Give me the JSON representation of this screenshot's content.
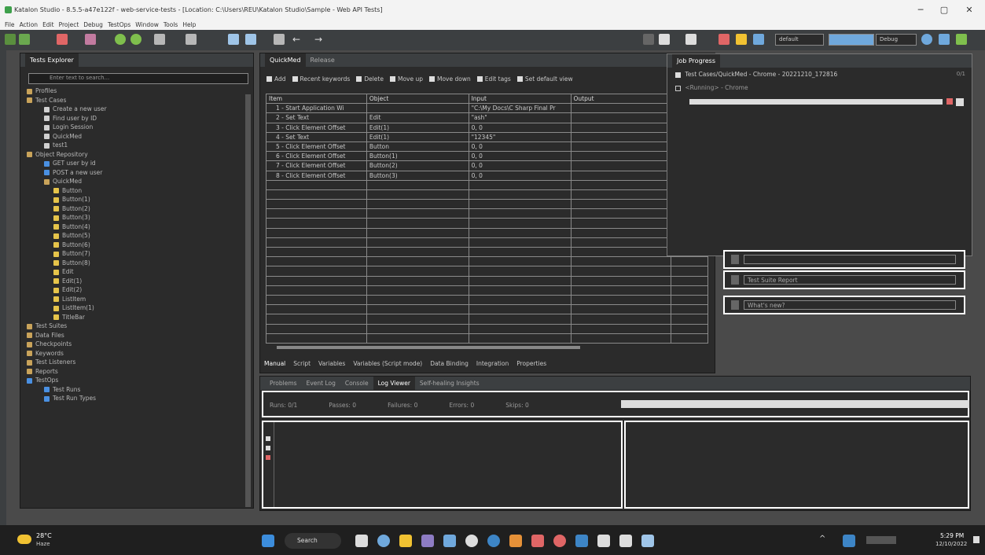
{
  "window": {
    "title": "Katalon Studio - 8.5.5-a47e122f - web-service-tests - [Location: C:\\Users\\REU\\Katalon Studio\\Sample - Web API Tests]",
    "minimize": "─",
    "maximize": "▢",
    "close": "✕"
  },
  "menu": [
    "File",
    "Action",
    "Edit",
    "Project",
    "Debug",
    "TestOps",
    "Window",
    "Tools",
    "Help"
  ],
  "toolbar": {
    "profile_select": "default",
    "debug_label": "Debug"
  },
  "tests_explorer": {
    "title": "Tests Explorer",
    "search_placeholder": "Enter text to search...",
    "tree": [
      {
        "label": "Profiles",
        "indent": 0,
        "icon": "folder"
      },
      {
        "label": "Test Cases",
        "indent": 0,
        "icon": "folder"
      },
      {
        "label": "Create a new user",
        "indent": 1,
        "icon": "testcase"
      },
      {
        "label": "Find user by ID",
        "indent": 1,
        "icon": "testcase"
      },
      {
        "label": "Login Session",
        "indent": 1,
        "icon": "testcase"
      },
      {
        "label": "QuickMed",
        "indent": 1,
        "icon": "testcase"
      },
      {
        "label": "test1",
        "indent": 1,
        "icon": "testcase"
      },
      {
        "label": "Object Repository",
        "indent": 0,
        "icon": "folder"
      },
      {
        "label": "GET user by id",
        "indent": 1,
        "icon": "request"
      },
      {
        "label": "POST a new user",
        "indent": 1,
        "icon": "request"
      },
      {
        "label": "QuickMed",
        "indent": 1,
        "icon": "folder"
      },
      {
        "label": "Button",
        "indent": 2,
        "icon": "object"
      },
      {
        "label": "Button(1)",
        "indent": 2,
        "icon": "object"
      },
      {
        "label": "Button(2)",
        "indent": 2,
        "icon": "object"
      },
      {
        "label": "Button(3)",
        "indent": 2,
        "icon": "object"
      },
      {
        "label": "Button(4)",
        "indent": 2,
        "icon": "object"
      },
      {
        "label": "Button(5)",
        "indent": 2,
        "icon": "object"
      },
      {
        "label": "Button(6)",
        "indent": 2,
        "icon": "object"
      },
      {
        "label": "Button(7)",
        "indent": 2,
        "icon": "object"
      },
      {
        "label": "Button(8)",
        "indent": 2,
        "icon": "object"
      },
      {
        "label": "Edit",
        "indent": 2,
        "icon": "object"
      },
      {
        "label": "Edit(1)",
        "indent": 2,
        "icon": "object"
      },
      {
        "label": "Edit(2)",
        "indent": 2,
        "icon": "object"
      },
      {
        "label": "ListItem",
        "indent": 2,
        "icon": "object"
      },
      {
        "label": "ListItem(1)",
        "indent": 2,
        "icon": "object"
      },
      {
        "label": "TitleBar",
        "indent": 2,
        "icon": "object"
      },
      {
        "label": "Test Suites",
        "indent": 0,
        "icon": "folder"
      },
      {
        "label": "Data Files",
        "indent": 0,
        "icon": "folder"
      },
      {
        "label": "Checkpoints",
        "indent": 0,
        "icon": "folder"
      },
      {
        "label": "Keywords",
        "indent": 0,
        "icon": "folder"
      },
      {
        "label": "Test Listeners",
        "indent": 0,
        "icon": "folder"
      },
      {
        "label": "Reports",
        "indent": 0,
        "icon": "folder"
      },
      {
        "label": "TestOps",
        "indent": 0,
        "icon": "testops"
      },
      {
        "label": "Test Runs",
        "indent": 1,
        "icon": "testops"
      },
      {
        "label": "Test Run Types",
        "indent": 1,
        "icon": "testops"
      }
    ]
  },
  "editor": {
    "tabs": [
      {
        "label": "QuickMed",
        "active": true
      },
      {
        "label": "Release",
        "active": false
      }
    ],
    "toolbar": [
      "Add",
      "Recent keywords",
      "Delete",
      "Move up",
      "Move down",
      "Edit tags",
      "Set default view"
    ],
    "columns": [
      "Item",
      "Object",
      "Input",
      "Output"
    ],
    "rows": [
      {
        "item": "1 - Start Application Wi",
        "object": "",
        "input": "\"C:\\My Docs\\C Sharp Final Pr",
        "output": ""
      },
      {
        "item": "2 - Set Text",
        "object": "Edit",
        "input": "\"ash\"",
        "output": ""
      },
      {
        "item": "3 - Click Element Offset",
        "object": "Edit(1)",
        "input": "0, 0",
        "output": ""
      },
      {
        "item": "4 - Set Text",
        "object": "Edit(1)",
        "input": "\"12345\"",
        "output": ""
      },
      {
        "item": "5 - Click Element Offset",
        "object": "Button",
        "input": "0, 0",
        "output": ""
      },
      {
        "item": "6 - Click Element Offset",
        "object": "Button(1)",
        "input": "0, 0",
        "output": ""
      },
      {
        "item": "7 - Click Element Offset",
        "object": "Button(2)",
        "input": "0, 0",
        "output": ""
      },
      {
        "item": "8 - Click Element Offset",
        "object": "Button(3)",
        "input": "0, 0",
        "output": ""
      }
    ],
    "bottom_tabs": [
      "Manual",
      "Script",
      "Variables",
      "Variables (Script mode)",
      "Data Binding",
      "Integration",
      "Properties"
    ]
  },
  "job_progress": {
    "title": "Job Progress",
    "job": "Test Cases/QuickMed - Chrome - 20221210_172816",
    "status": "<Running> - Chrome",
    "counter": "0/1"
  },
  "right_ribbons": [
    "",
    "Test Suite Report",
    "What's new?"
  ],
  "log": {
    "tabs": [
      "Problems",
      "Event Log",
      "Console",
      "Log Viewer",
      "Self-healing Insights"
    ],
    "active_tab": "Log Viewer",
    "stats": [
      "Runs: 0/1",
      "Passes: 0",
      "Failures: 0",
      "Errors: 0",
      "Skips: 0"
    ]
  },
  "taskbar": {
    "weather_temp": "28°C",
    "weather_desc": "Haze",
    "search": "Search",
    "time": "5:29 PM",
    "date": "12/10/2022"
  }
}
